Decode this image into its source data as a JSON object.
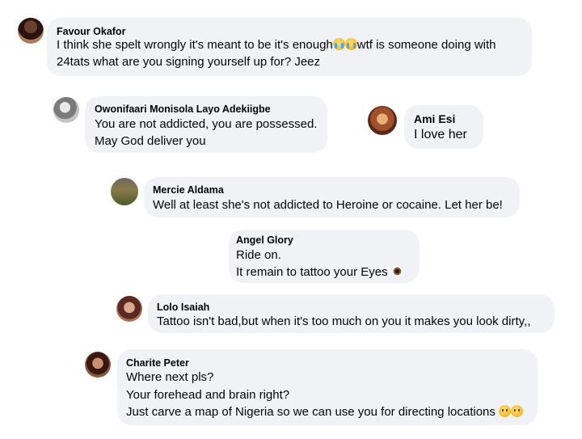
{
  "comments": [
    {
      "name": "Favour Okafor",
      "lines": [
        "I think she spelt wrongly it's meant to be it's enough",
        "wtf is someone doing with",
        "24tats what are you signing yourself up for? Jeez"
      ]
    },
    {
      "name": "Owonifaari Monisola Layo Adekiigbe",
      "lines": [
        "You are not addicted, you are possessed.",
        "May God deliver you"
      ]
    },
    {
      "name": "Ami Esi",
      "lines": [
        "I love her"
      ]
    },
    {
      "name": "Mercie Aldama",
      "lines": [
        "Well at least she's not addicted to Heroine or cocaine. Let her be!"
      ]
    },
    {
      "name": "Angel Glory",
      "lines": [
        "Ride on.",
        "It remain to tattoo your Eyes"
      ]
    },
    {
      "name": "Lolo Isaiah",
      "lines": [
        "Tattoo isn't bad,but when it's too much on you it makes you look dirty,,"
      ]
    },
    {
      "name": "Charite Peter",
      "lines": [
        "Where next pls?",
        "Your forehead and brain right?",
        "Just carve a map of Nigeria so we can use you for directing locations"
      ]
    }
  ],
  "icons": {
    "crying": "loudly-crying-face-icon",
    "eye": "eye-icon",
    "sad": "sad-face-icon"
  },
  "colors": {
    "bubble_bg": "#f0f2f5",
    "text": "#050505"
  }
}
